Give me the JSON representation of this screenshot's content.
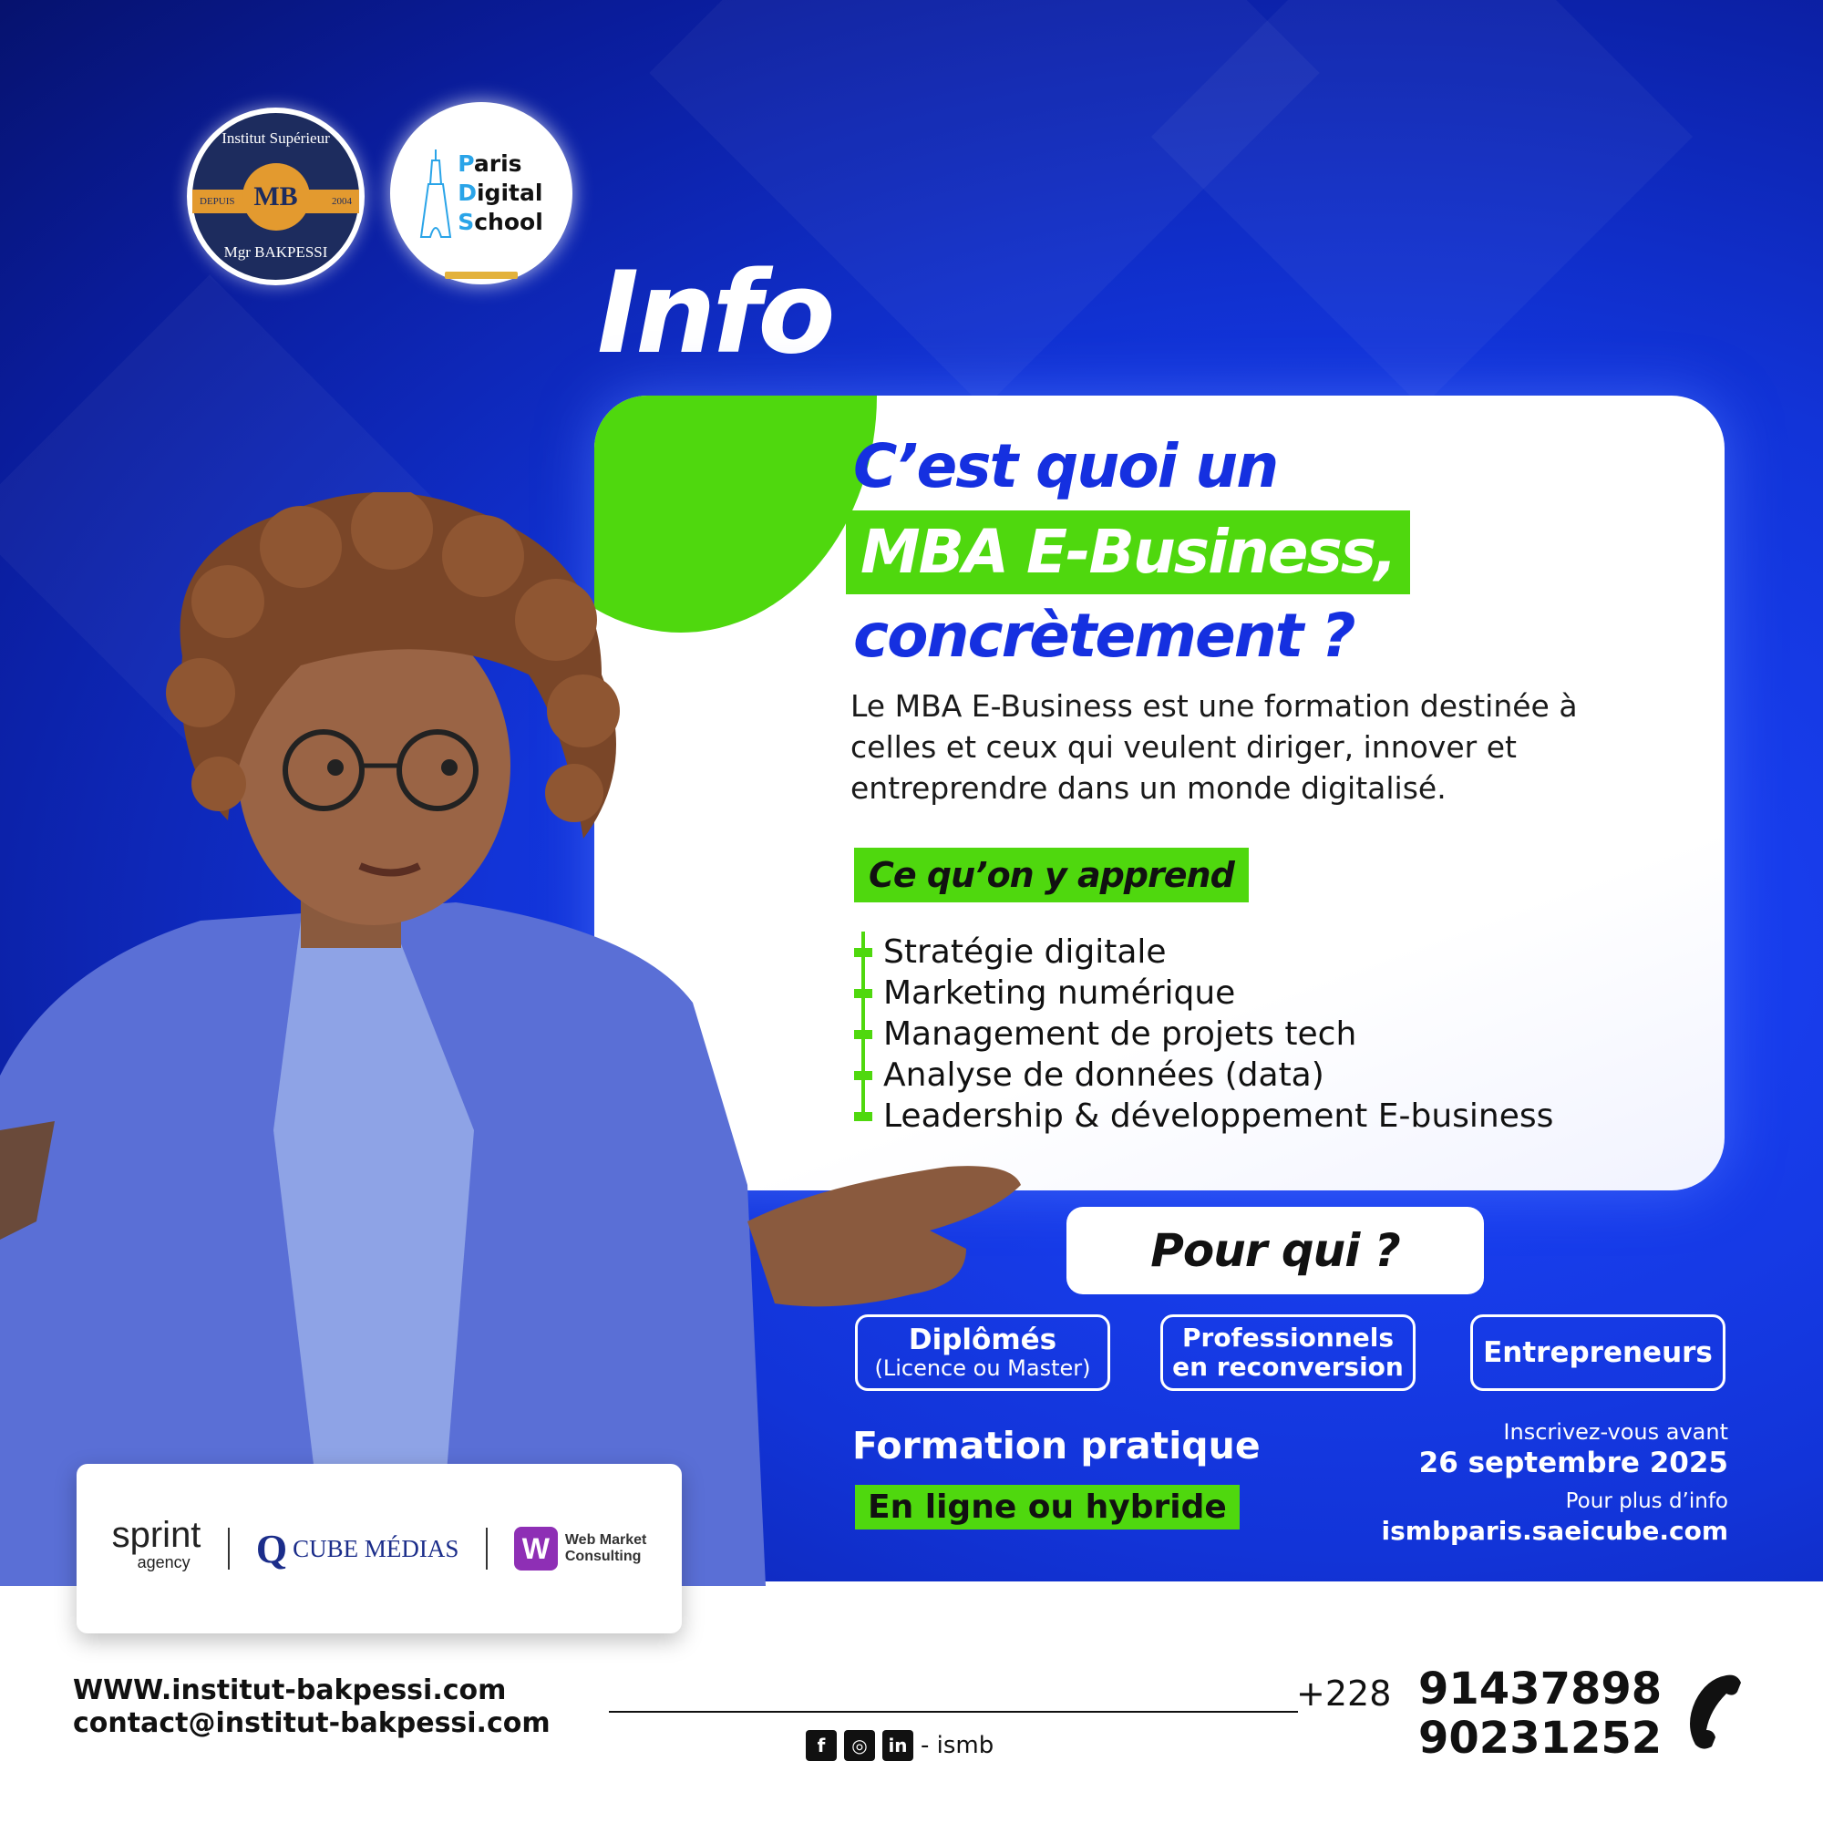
{
  "logos": {
    "ismb": {
      "ring_top": "Institut Supérieur",
      "ring_bottom": "Mgr BAKPESSI",
      "left": "DEPUIS",
      "right": "2004",
      "monogram": "MB"
    },
    "pds": {
      "line1_first": "P",
      "line1_rest": "aris",
      "line2_first": "D",
      "line2_rest": "igital",
      "line3_first": "S",
      "line3_rest": "chool"
    }
  },
  "title": "Info",
  "headline": {
    "line1": "C’est quoi un",
    "line2": "MBA E-Business,",
    "line3": "concrètement ?"
  },
  "description": "Le MBA E-Business est une formation destinée à celles et ceux qui veulent diriger, innover et entreprendre dans un monde digitalisé.",
  "learn": {
    "heading": "Ce qu’on y apprend",
    "items": [
      "Stratégie digitale",
      "Marketing numérique",
      "Management de projets tech",
      "Analyse de données (data)",
      "Leadership & développement E-business"
    ]
  },
  "audience": {
    "heading": "Pour qui ?",
    "groups": [
      {
        "title": "Diplômés",
        "subtitle": "(Licence ou Master)"
      },
      {
        "title": "Professionnels",
        "subtitle": "en reconversion"
      },
      {
        "title": "Entrepreneurs"
      }
    ]
  },
  "formation": {
    "label": "Formation pratique",
    "mode": "En ligne ou hybride"
  },
  "deadline": {
    "intro": "Inscrivez-vous avant",
    "date": "26 septembre 2025",
    "info_label": "Pour plus d’info",
    "site": "ismbparis.saeicube.com"
  },
  "partners": {
    "sprint": {
      "name": "sprint",
      "sub": "agency"
    },
    "cube": {
      "name": "CUBE MÉDIAS"
    },
    "wmc": {
      "line1": "Web Market",
      "line2": "Consulting"
    }
  },
  "footer": {
    "website": "WWW.institut-bakpessi.com",
    "email": "contact@institut-bakpessi.com",
    "social_handle": "- ismb",
    "phone_code": "+228",
    "phone1": "91437898",
    "phone2": "90231252"
  },
  "colors": {
    "brand_blue": "#1530e0",
    "accent_green": "#4fd80e"
  }
}
